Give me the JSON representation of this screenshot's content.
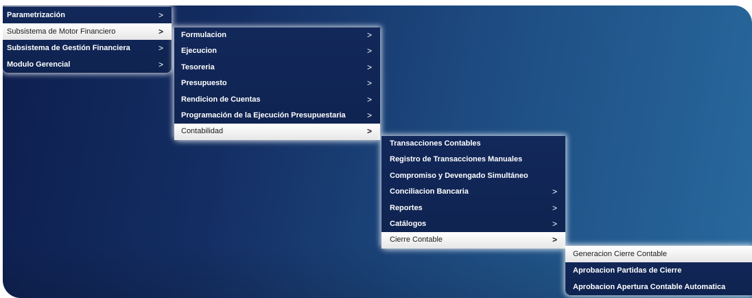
{
  "menu_level1": {
    "items": [
      {
        "label": "Parametrización",
        "arrow": ">",
        "active": false
      },
      {
        "label": "Subsistema de Motor Financiero",
        "arrow": ">",
        "active": true
      },
      {
        "label": "Subsistema de Gestión Financiera",
        "arrow": ">",
        "active": false
      },
      {
        "label": "Modulo Gerencial",
        "arrow": ">",
        "active": false
      }
    ]
  },
  "menu_level2": {
    "items": [
      {
        "label": "Formulacion",
        "arrow": ">",
        "active": false
      },
      {
        "label": "Ejecucion",
        "arrow": ">",
        "active": false
      },
      {
        "label": "Tesoreria",
        "arrow": ">",
        "active": false
      },
      {
        "label": "Presupuesto",
        "arrow": ">",
        "active": false
      },
      {
        "label": "Rendicion de Cuentas",
        "arrow": ">",
        "active": false
      },
      {
        "label": "Programación de la Ejecución Presupuestaria",
        "arrow": ">",
        "active": false
      },
      {
        "label": "Contabilidad",
        "arrow": ">",
        "active": true
      }
    ]
  },
  "menu_level3": {
    "items": [
      {
        "label": "Transacciones Contables",
        "arrow": "",
        "active": false
      },
      {
        "label": "Registro de Transacciones Manuales",
        "arrow": "",
        "active": false
      },
      {
        "label": "Compromiso y Devengado Simultáneo",
        "arrow": "",
        "active": false
      },
      {
        "label": "Conciliacion Bancaria",
        "arrow": ">",
        "active": false
      },
      {
        "label": "Reportes",
        "arrow": ">",
        "active": false
      },
      {
        "label": "Catálogos",
        "arrow": ">",
        "active": false
      },
      {
        "label": "Cierre Contable",
        "arrow": ">",
        "active": true
      }
    ]
  },
  "menu_level4": {
    "items": [
      {
        "label": "Generacion Cierre Contable",
        "arrow": "",
        "active": true
      },
      {
        "label": "Aprobacion Partidas de Cierre",
        "arrow": "",
        "active": false
      },
      {
        "label": "Aprobacion Apertura Contable Automatica",
        "arrow": "",
        "active": false
      }
    ]
  }
}
